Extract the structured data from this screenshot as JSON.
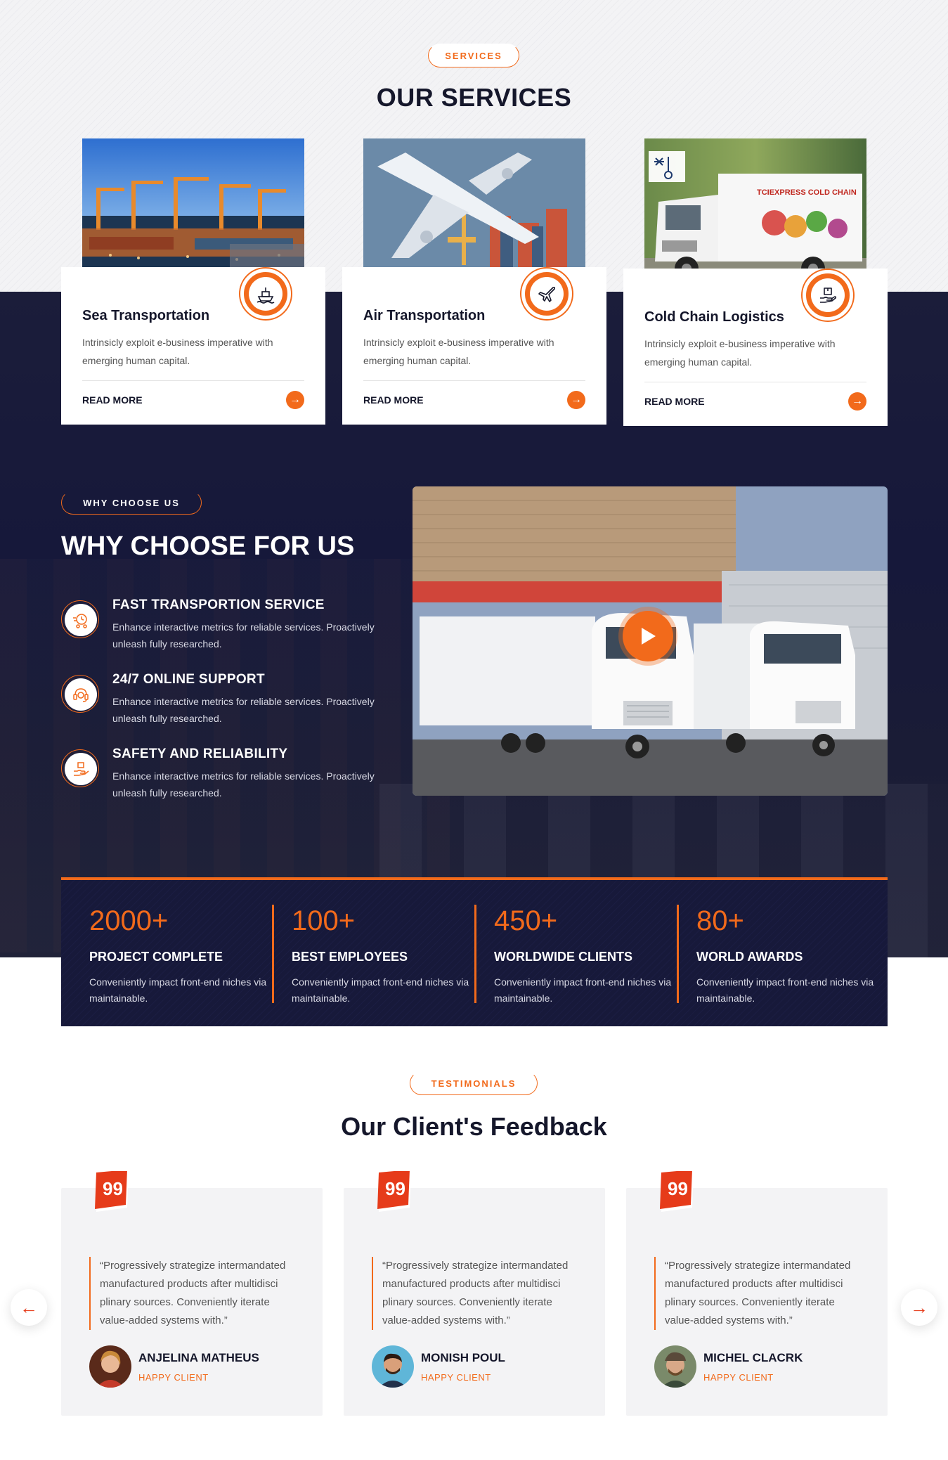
{
  "colors": {
    "accent": "#f26a1b",
    "navy": "#16183a",
    "text": "#15172b"
  },
  "services": {
    "tag": "SERVICES",
    "title": "OUR SERVICES",
    "cards": [
      {
        "title": "Sea Transportation",
        "desc": "Intrinsicly exploit e-business imperative with emerging human capital.",
        "more": "READ MORE",
        "icon": "ship-icon"
      },
      {
        "title": "Air Transportation",
        "desc": "Intrinsicly exploit e-business imperative with emerging human capital.",
        "more": "READ MORE",
        "icon": "airplane-icon"
      },
      {
        "title": "Cold Chain Logistics",
        "desc": "Intrinsicly exploit e-business imperative with emerging human capital.",
        "more": "READ MORE",
        "icon": "box-hand-icon"
      }
    ],
    "truck_brand": "TCIEXPRESS COLD CHAIN"
  },
  "why": {
    "tag": "WHY CHOOSE US",
    "title": "WHY CHOOSE FOR US",
    "features": [
      {
        "title": "FAST TRANSPORTION SERVICE",
        "desc": "Enhance interactive metrics for reliable services. Proactively unleash fully researched.",
        "icon": "fast-delivery-icon"
      },
      {
        "title": "24/7 ONLINE SUPPORT",
        "desc": "Enhance interactive metrics for reliable services. Proactively unleash fully researched.",
        "icon": "support-icon"
      },
      {
        "title": "SAFETY AND RELIABILITY",
        "desc": "Enhance interactive metrics for reliable services. Proactively unleash fully researched.",
        "icon": "safety-hand-icon"
      }
    ]
  },
  "counters": [
    {
      "num": "2000+",
      "label": "PROJECT COMPLETE",
      "text": "Conveniently impact front-end niches via maintainable."
    },
    {
      "num": "100+",
      "label": "BEST EMPLOYEES",
      "text": "Conveniently impact front-end niches via maintainable."
    },
    {
      "num": "450+",
      "label": "WORLDWIDE CLIENTS",
      "text": "Conveniently impact front-end niches via maintainable."
    },
    {
      "num": "80+",
      "label": "WORLD AWARDS",
      "text": "Conveniently impact front-end niches via maintainable."
    }
  ],
  "testimonials": {
    "tag": "TESTIMONIALS",
    "title": "Our Client's Feedback",
    "items": [
      {
        "quote": "“Progressively strategize intermandated manufactured products after multidisci plinary sources. Conveniently iterate value-added systems with.”",
        "name": "ANJELINA MATHEUS",
        "role": "HAPPY CLIENT"
      },
      {
        "quote": "“Progressively strategize intermandated manufactured products after multidisci plinary sources. Conveniently iterate value-added systems with.”",
        "name": "MONISH POUL",
        "role": "HAPPY CLIENT"
      },
      {
        "quote": "“Progressively strategize intermandated manufactured products after multidisci plinary sources. Conveniently iterate value-added systems with.”",
        "name": "MICHEL CLACRK",
        "role": "HAPPY CLIENT"
      }
    ],
    "prev_icon": "arrow-left-icon",
    "next_icon": "arrow-right-icon"
  }
}
